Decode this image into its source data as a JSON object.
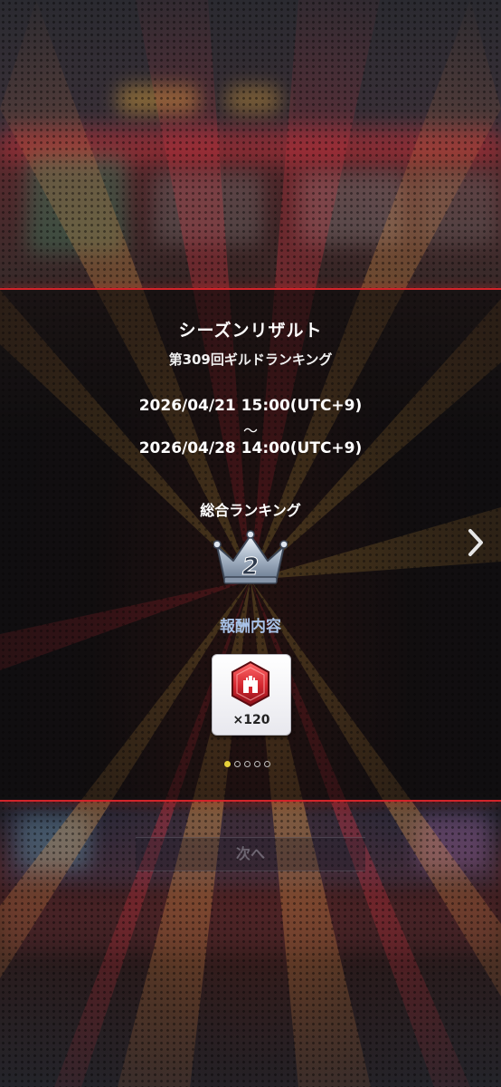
{
  "result": {
    "title": "シーズンリザルト",
    "subtitle": "第309回ギルドランキング",
    "period_start": "2026/04/21 15:00(UTC+9)",
    "period_separator": "〜",
    "period_end": "2026/04/28 14:00(UTC+9)",
    "ranking_label": "総合ランキング",
    "rank": "2",
    "reward_label": "報酬内容",
    "reward": {
      "icon": "red-castle-gem-icon",
      "quantity": "×120"
    },
    "pager": {
      "total": 5,
      "current": 1
    }
  },
  "footer": {
    "next_label": "次へ"
  },
  "colors": {
    "panel_border": "#d2242a",
    "reward_label": "#a9c3e8",
    "pager_active": "#e8d23a",
    "gem": "#d3252e"
  }
}
